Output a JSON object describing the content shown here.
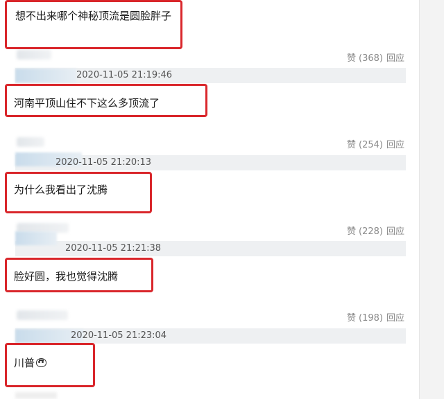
{
  "comments": [
    {
      "text": "想不出来哪个神秘顶流是圆脸胖子"
    },
    {
      "text": "河南平顶山住不下这么多顶流了",
      "timestamp": "2020-11-05 21:19:46"
    },
    {
      "text": "为什么我看出了沈腾",
      "timestamp": "2020-11-05 21:20:13"
    },
    {
      "text": "脸好圆，我也觉得沈腾",
      "timestamp": "2020-11-05 21:21:38"
    },
    {
      "text": "川普",
      "emoji": "face-emoji",
      "timestamp": "2020-11-05 21:23:04"
    }
  ],
  "reply_actions": [
    {
      "like_label": "赞",
      "like_count": "(368)",
      "reply_label": "回应"
    },
    {
      "like_label": "赞",
      "like_count": "(254)",
      "reply_label": "回应"
    },
    {
      "like_label": "赞",
      "like_count": "(228)",
      "reply_label": "回应"
    },
    {
      "like_label": "赞",
      "like_count": "(198)",
      "reply_label": "回应"
    }
  ],
  "colors": {
    "highlight": "#d9262b",
    "meta_bar": "#eef0f2",
    "muted_text": "#8a8a8a"
  }
}
